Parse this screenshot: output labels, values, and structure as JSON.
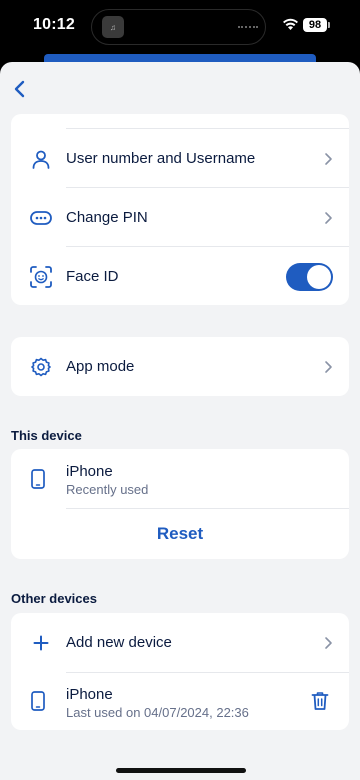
{
  "status_bar": {
    "time": "10:12",
    "battery": "98"
  },
  "colors": {
    "accent": "#1f5cc0",
    "background": "#f2f3f5",
    "text": "#0b1b3f",
    "subtext": "#66708a"
  },
  "security_card": {
    "items": [
      {
        "label": "User number and Username",
        "icon": "user-icon"
      },
      {
        "label": "Change PIN",
        "icon": "pin-dots-icon"
      },
      {
        "label": "Face ID",
        "icon": "face-id-icon",
        "toggle_on": true
      }
    ]
  },
  "app_mode": {
    "label": "App mode",
    "icon": "gear-icon"
  },
  "this_device": {
    "section_title": "This device",
    "device_name": "iPhone",
    "device_status": "Recently used",
    "reset_label": "Reset"
  },
  "other_devices": {
    "section_title": "Other devices",
    "add_label": "Add new device",
    "device_name": "iPhone",
    "device_status": "Last used on 04/07/2024, 22:36"
  }
}
